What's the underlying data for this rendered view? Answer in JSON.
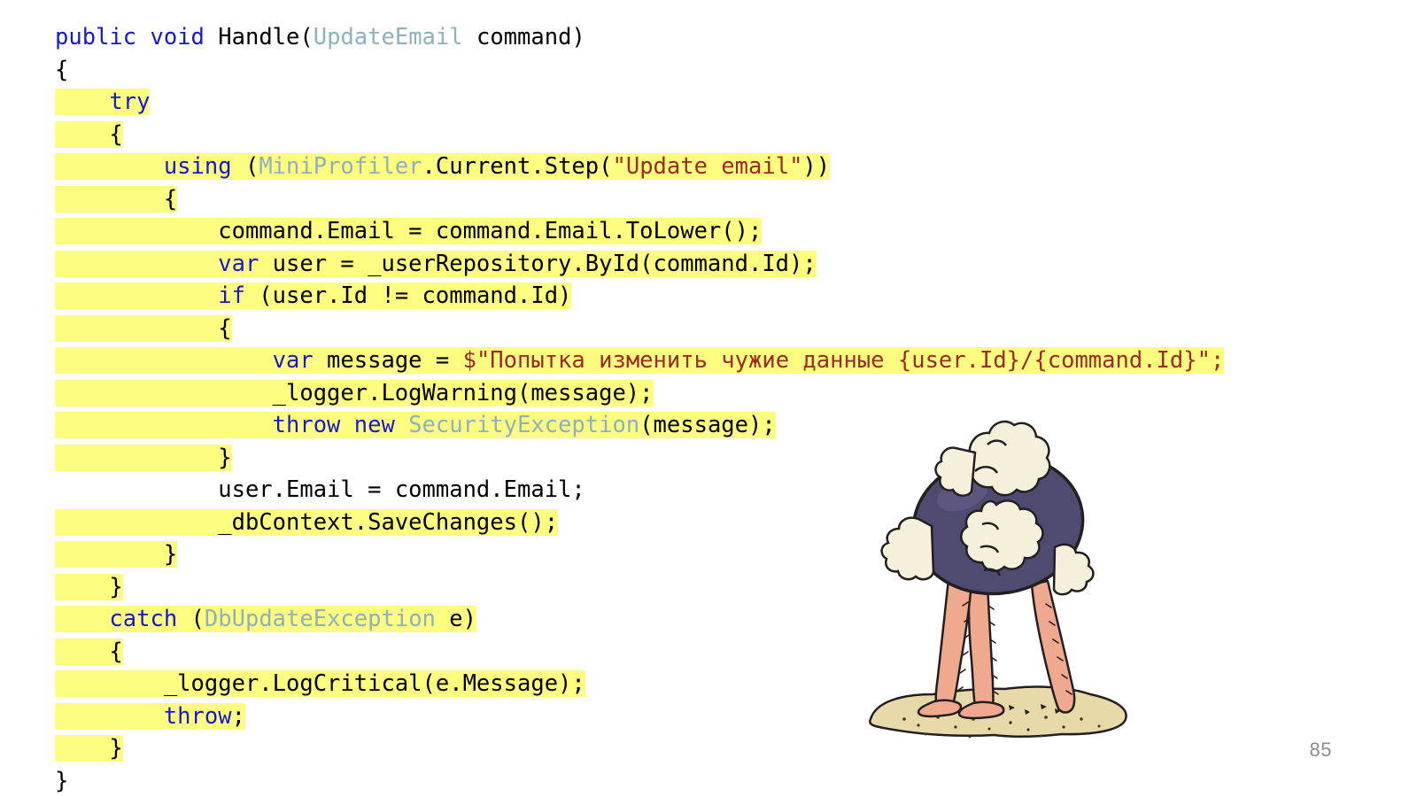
{
  "slide": {
    "page_number": "85",
    "background_color": "#ffffff",
    "highlight_color": "#fdfd80"
  },
  "palette": {
    "keyword": "#1818cc",
    "type": "#8fb0bd",
    "string": "#9c2b22",
    "plain": "#000000",
    "highlight": "#fdfd80",
    "page_number": "#8c8c8c",
    "ostrich_body": "#4f4a70",
    "ostrich_feather": "#f5f0dc",
    "ostrich_leg": "#efa98f",
    "ostrich_sand": "#e8d9a8",
    "outline": "#231f20"
  },
  "code": {
    "language": "csharp",
    "lines": [
      {
        "indent": 0,
        "highlighted": false,
        "text": "public void Handle(UpdateEmail command)",
        "tokens": [
          {
            "t": "public",
            "c": "kw"
          },
          {
            "t": " ",
            "c": "pln"
          },
          {
            "t": "void",
            "c": "kw"
          },
          {
            "t": " Handle(",
            "c": "pln"
          },
          {
            "t": "UpdateEmail",
            "c": "type"
          },
          {
            "t": " command)",
            "c": "pln"
          }
        ]
      },
      {
        "indent": 0,
        "highlighted": false,
        "text": "{",
        "tokens": [
          {
            "t": "{",
            "c": "pln"
          }
        ]
      },
      {
        "indent": 1,
        "highlighted": true,
        "text": "try",
        "tokens": [
          {
            "t": "try",
            "c": "kw"
          }
        ]
      },
      {
        "indent": 1,
        "highlighted": true,
        "text": "{",
        "tokens": [
          {
            "t": "{",
            "c": "pln"
          }
        ]
      },
      {
        "indent": 2,
        "highlighted": true,
        "text": "using (MiniProfiler.Current.Step(\"Update email\"))",
        "tokens": [
          {
            "t": "using",
            "c": "kw"
          },
          {
            "t": " (",
            "c": "pln"
          },
          {
            "t": "MiniProfiler",
            "c": "type"
          },
          {
            "t": ".Current.Step(",
            "c": "pln"
          },
          {
            "t": "\"Update email\"",
            "c": "str"
          },
          {
            "t": "))",
            "c": "pln"
          }
        ]
      },
      {
        "indent": 2,
        "highlighted": true,
        "text": "{",
        "tokens": [
          {
            "t": "{",
            "c": "pln"
          }
        ]
      },
      {
        "indent": 3,
        "highlighted": true,
        "text": "command.Email = command.Email.ToLower();",
        "tokens": [
          {
            "t": "command.Email = command.Email.ToLower();",
            "c": "pln"
          }
        ]
      },
      {
        "indent": 3,
        "highlighted": true,
        "text": "var user = _userRepository.ById(command.Id);",
        "tokens": [
          {
            "t": "var",
            "c": "kw"
          },
          {
            "t": " user = _userRepository.ById(command.Id);",
            "c": "pln"
          }
        ]
      },
      {
        "indent": 3,
        "highlighted": true,
        "text": "if (user.Id != command.Id)",
        "tokens": [
          {
            "t": "if",
            "c": "kw"
          },
          {
            "t": " (user.Id != command.Id)",
            "c": "pln"
          }
        ]
      },
      {
        "indent": 3,
        "highlighted": true,
        "text": "{",
        "tokens": [
          {
            "t": "{",
            "c": "pln"
          }
        ]
      },
      {
        "indent": 4,
        "highlighted": true,
        "text": "var message = $\"Попытка изменить чужие данные {user.Id}/{command.Id}\";",
        "tokens": [
          {
            "t": "var",
            "c": "kw"
          },
          {
            "t": " message = ",
            "c": "pln"
          },
          {
            "t": "$\"Попытка изменить чужие данные {user.Id}/{command.Id}\";",
            "c": "str"
          }
        ]
      },
      {
        "indent": 4,
        "highlighted": true,
        "text": "_logger.LogWarning(message);",
        "tokens": [
          {
            "t": "_logger.LogWarning(message);",
            "c": "pln"
          }
        ]
      },
      {
        "indent": 4,
        "highlighted": true,
        "text": "throw new SecurityException(message);",
        "tokens": [
          {
            "t": "throw",
            "c": "kw"
          },
          {
            "t": " ",
            "c": "pln"
          },
          {
            "t": "new",
            "c": "kw"
          },
          {
            "t": " ",
            "c": "pln"
          },
          {
            "t": "SecurityException",
            "c": "type"
          },
          {
            "t": "(message);",
            "c": "pln"
          }
        ]
      },
      {
        "indent": 3,
        "highlighted": true,
        "text": "}",
        "tokens": [
          {
            "t": "}",
            "c": "pln"
          }
        ]
      },
      {
        "indent": 3,
        "highlighted": false,
        "text": "user.Email = command.Email;",
        "tokens": [
          {
            "t": "user.Email = command.Email;",
            "c": "pln"
          }
        ]
      },
      {
        "indent": 3,
        "highlighted": true,
        "text": "_dbContext.SaveChanges();",
        "tokens": [
          {
            "t": "_dbContext.SaveChanges();",
            "c": "pln"
          }
        ]
      },
      {
        "indent": 2,
        "highlighted": true,
        "text": "}",
        "tokens": [
          {
            "t": "}",
            "c": "pln"
          }
        ]
      },
      {
        "indent": 1,
        "highlighted": true,
        "text": "}",
        "tokens": [
          {
            "t": "}",
            "c": "pln"
          }
        ]
      },
      {
        "indent": 1,
        "highlighted": true,
        "text": "catch (DbUpdateException e)",
        "tokens": [
          {
            "t": "catch",
            "c": "kw"
          },
          {
            "t": " (",
            "c": "pln"
          },
          {
            "t": "DbUpdateException",
            "c": "type"
          },
          {
            "t": " e)",
            "c": "pln"
          }
        ]
      },
      {
        "indent": 1,
        "highlighted": true,
        "text": "{",
        "tokens": [
          {
            "t": "{",
            "c": "pln"
          }
        ]
      },
      {
        "indent": 2,
        "highlighted": true,
        "text": "_logger.LogCritical(e.Message);",
        "tokens": [
          {
            "t": "_logger.LogCritical(e.Message);",
            "c": "pln"
          }
        ]
      },
      {
        "indent": 2,
        "highlighted": true,
        "text": "throw;",
        "tokens": [
          {
            "t": "throw",
            "c": "kw"
          },
          {
            "t": ";",
            "c": "pln"
          }
        ]
      },
      {
        "indent": 1,
        "highlighted": true,
        "text": "}",
        "tokens": [
          {
            "t": "}",
            "c": "pln"
          }
        ]
      },
      {
        "indent": 0,
        "highlighted": false,
        "text": "}",
        "tokens": [
          {
            "t": "}",
            "c": "pln"
          }
        ]
      }
    ]
  },
  "illustration": {
    "name": "ostrich-head-in-sand",
    "description": "Cartoon ostrich with its head buried in a mound of sand"
  }
}
